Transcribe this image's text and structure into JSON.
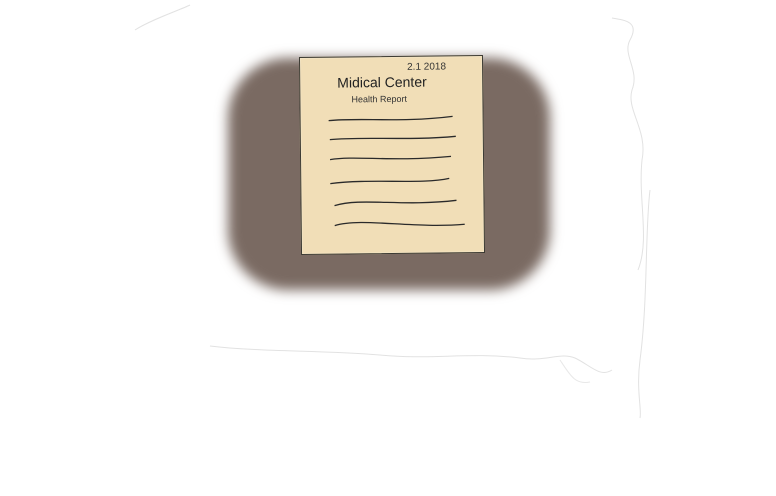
{
  "document": {
    "date": "2.1 2018",
    "title": "Midical Center",
    "subtitle": "Health Report"
  },
  "colors": {
    "background": "#ffffff",
    "table": "#7a6a62",
    "paper": "#f1deb7",
    "ink": "#2a2a2a",
    "sketch_line": "#dddddd"
  }
}
